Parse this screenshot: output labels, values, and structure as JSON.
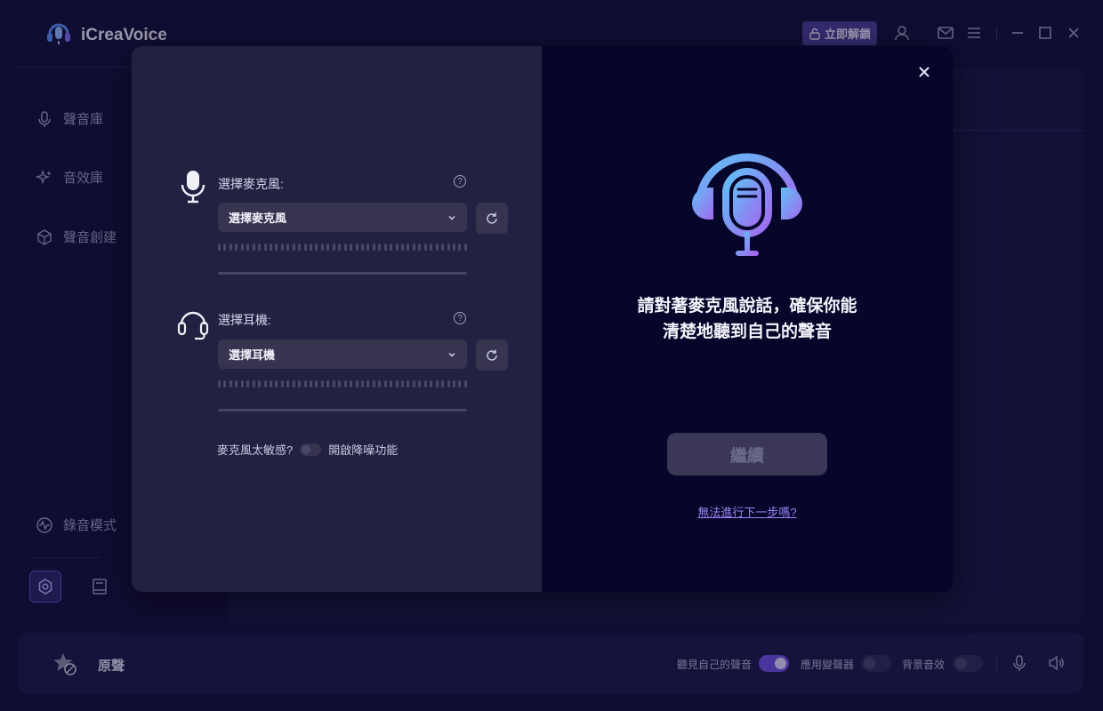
{
  "app": {
    "title": "iCreaVoice",
    "unlock_label": "立即解鎖"
  },
  "sidebar": {
    "items": [
      {
        "label": "聲音庫",
        "icon": "mic-icon"
      },
      {
        "label": "音效庫",
        "icon": "sparkle-icon"
      },
      {
        "label": "聲音創建",
        "icon": "cube-icon"
      },
      {
        "label": "錄音模式",
        "icon": "waveform-icon"
      }
    ]
  },
  "bottombar": {
    "voice_name": "原聲",
    "hear_self_label": "聽見自己的聲音",
    "apply_changer_label": "應用變聲器",
    "bg_sound_label": "背景音效",
    "hear_self_on": true,
    "apply_changer_on": false,
    "bg_sound_on": false
  },
  "modal": {
    "mic": {
      "label": "選擇麥克風:",
      "selected": "選擇麥克風"
    },
    "headset": {
      "label": "選擇耳機:",
      "selected": "選擇耳機"
    },
    "noise": {
      "question": "麥克風太敏感?",
      "toggle_label": "開啟降噪功能",
      "on": false
    },
    "prompt_line1": "請對著麥克風說話，確保你能",
    "prompt_line2": "清楚地聽到自己的聲音",
    "continue_label": "繼續",
    "help_link": "無法進行下一步嗎?"
  },
  "colors": {
    "background": "#14123f",
    "accent": "#6f4fe0",
    "modal_left": "#232141",
    "modal_right": "#06052a"
  }
}
